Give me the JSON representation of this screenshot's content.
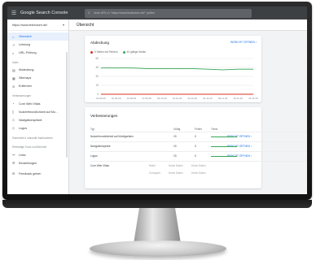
{
  "app": {
    "title": "Google Search Console",
    "search_placeholder": "Jede URL in \"https://www.testhosen.de/\" prüfen"
  },
  "sidebar": {
    "property": "https://www.testhosen.de/",
    "items_top": [
      {
        "label": "Übersicht",
        "icon": "home-icon",
        "glyph": "⌂",
        "active": true
      },
      {
        "label": "Leistung",
        "icon": "trend-icon",
        "glyph": "↗",
        "active": false
      },
      {
        "label": "URL-Prüfung",
        "icon": "search-icon",
        "glyph": "⌕",
        "active": false
      }
    ],
    "section_index": "Index",
    "items_index": [
      {
        "label": "Abdeckung",
        "icon": "coverage-icon",
        "glyph": "▤"
      },
      {
        "label": "Sitemaps",
        "icon": "sitemap-icon",
        "glyph": "▦"
      },
      {
        "label": "Entfernen",
        "icon": "remove-icon",
        "glyph": "⊘"
      }
    ],
    "section_improvements": "Verbesserungen",
    "items_improvements": [
      {
        "label": "Core Web Vitals",
        "icon": "gauge-icon",
        "glyph": "◔"
      },
      {
        "label": "Nutzerfreundlichkeit auf Mo…",
        "icon": "mobile-icon",
        "glyph": "▯"
      },
      {
        "label": "Navigationspfade",
        "icon": "layers-icon",
        "glyph": "◇"
      },
      {
        "label": "Logos",
        "icon": "layers-icon",
        "glyph": "◇"
      }
    ],
    "section_security": "Sicherheit & manuelle Maßnahmen",
    "section_legacy": "Ehemalige Tools und Berichte",
    "items_bottom": [
      {
        "label": "Links",
        "icon": "links-icon",
        "glyph": "⚯"
      },
      {
        "label": "Einstellungen",
        "icon": "gear-icon",
        "glyph": "⚙"
      }
    ],
    "feedback": {
      "label": "Feedback geben",
      "icon": "feedback-icon",
      "glyph": "✉"
    }
  },
  "main": {
    "page_title": "Übersicht",
    "coverage_card": {
      "title": "Abdeckung",
      "link": "BERICHT ÖFFNEN ›",
      "legend": [
        {
          "label": "0 Seiten mit Fehlern",
          "color": "#d93025"
        },
        {
          "label": "43 gültige Seiten",
          "color": "#34a853"
        }
      ]
    },
    "improvements_card": {
      "title": "Verbesserungen",
      "headers": {
        "type": "Typ",
        "valid": "Gültig",
        "errors": "Fehler",
        "trend": "Trend"
      },
      "rows": [
        {
          "type": "Nutzerfreundlichkeit auf Mobilgeräten",
          "valid": "19",
          "errors": "0",
          "link": "BERICHT ÖFFNEN ›"
        },
        {
          "type": "Navigationspfade",
          "valid": "19",
          "errors": "0",
          "link": "BERICHT ÖFFNEN ›"
        },
        {
          "type": "Logos",
          "valid": "19",
          "errors": "0",
          "link": "BERICHT ÖFFNEN ›"
        }
      ],
      "cwv": {
        "label": "Core Web Vitals",
        "rows": [
          "Mobil",
          "Computer"
        ],
        "value": "Keine Daten"
      }
    }
  },
  "chart_data": {
    "type": "line",
    "x": [
      "02.09.20",
      "10.09.20",
      "19.09.20",
      "27.09.20",
      "06.10.20",
      "14.10.20",
      "23.10.20",
      "01.11.20",
      "09.11.20",
      "18.11.20",
      "26.11.20"
    ],
    "series": [
      {
        "name": "43 gültige Seiten",
        "color": "#34a853",
        "values": [
          44,
          44,
          44,
          43,
          43,
          43,
          43,
          42,
          41,
          42,
          42
        ]
      },
      {
        "name": "0 Seiten mit Fehlern",
        "color": "#d93025",
        "values": [
          0,
          0,
          0,
          0,
          0,
          0,
          0,
          0,
          0,
          0,
          0
        ]
      }
    ],
    "y_ticks": [
      "60",
      "45",
      "30",
      "15",
      "0"
    ],
    "ylim": [
      0,
      60
    ],
    "grid": true
  }
}
